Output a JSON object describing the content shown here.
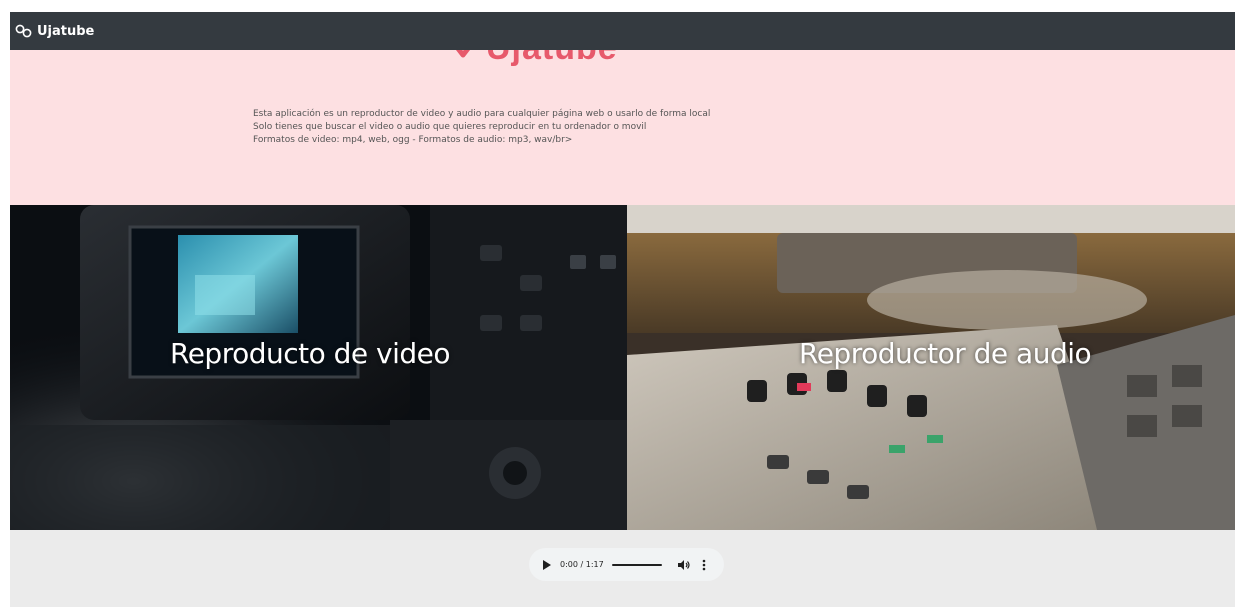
{
  "navbar": {
    "brand": "Ujatube",
    "brand_icon": "infinity-logo-icon"
  },
  "hero": {
    "logo_text": "Ujatube",
    "logo_icon": "ujatube-logo-icon",
    "description": [
      "Esta aplicación es un reproductor de video y audio para cualquier página web o usarlo de forma local",
      "Solo tienes que buscar el video o audio que quieres reproducir en tu ordenador o movil",
      "Formatos de video: mp4, web, ogg - Formatos de audio: mp3, wav/br>"
    ],
    "background": "#fde0e2"
  },
  "tiles": {
    "video": {
      "label": "Reproducto de video"
    },
    "audio": {
      "label": "Reproductor de audio"
    }
  },
  "audio_player": {
    "time": "0:00 / 1:17",
    "progress": 0,
    "play_icon": "play-icon",
    "volume_icon": "volume-icon",
    "more_icon": "more-vertical-icon"
  },
  "colors": {
    "navbar": "#343a40",
    "hero": "#fde0e2",
    "accent": "#e7596b",
    "footer": "#ebebeb"
  }
}
